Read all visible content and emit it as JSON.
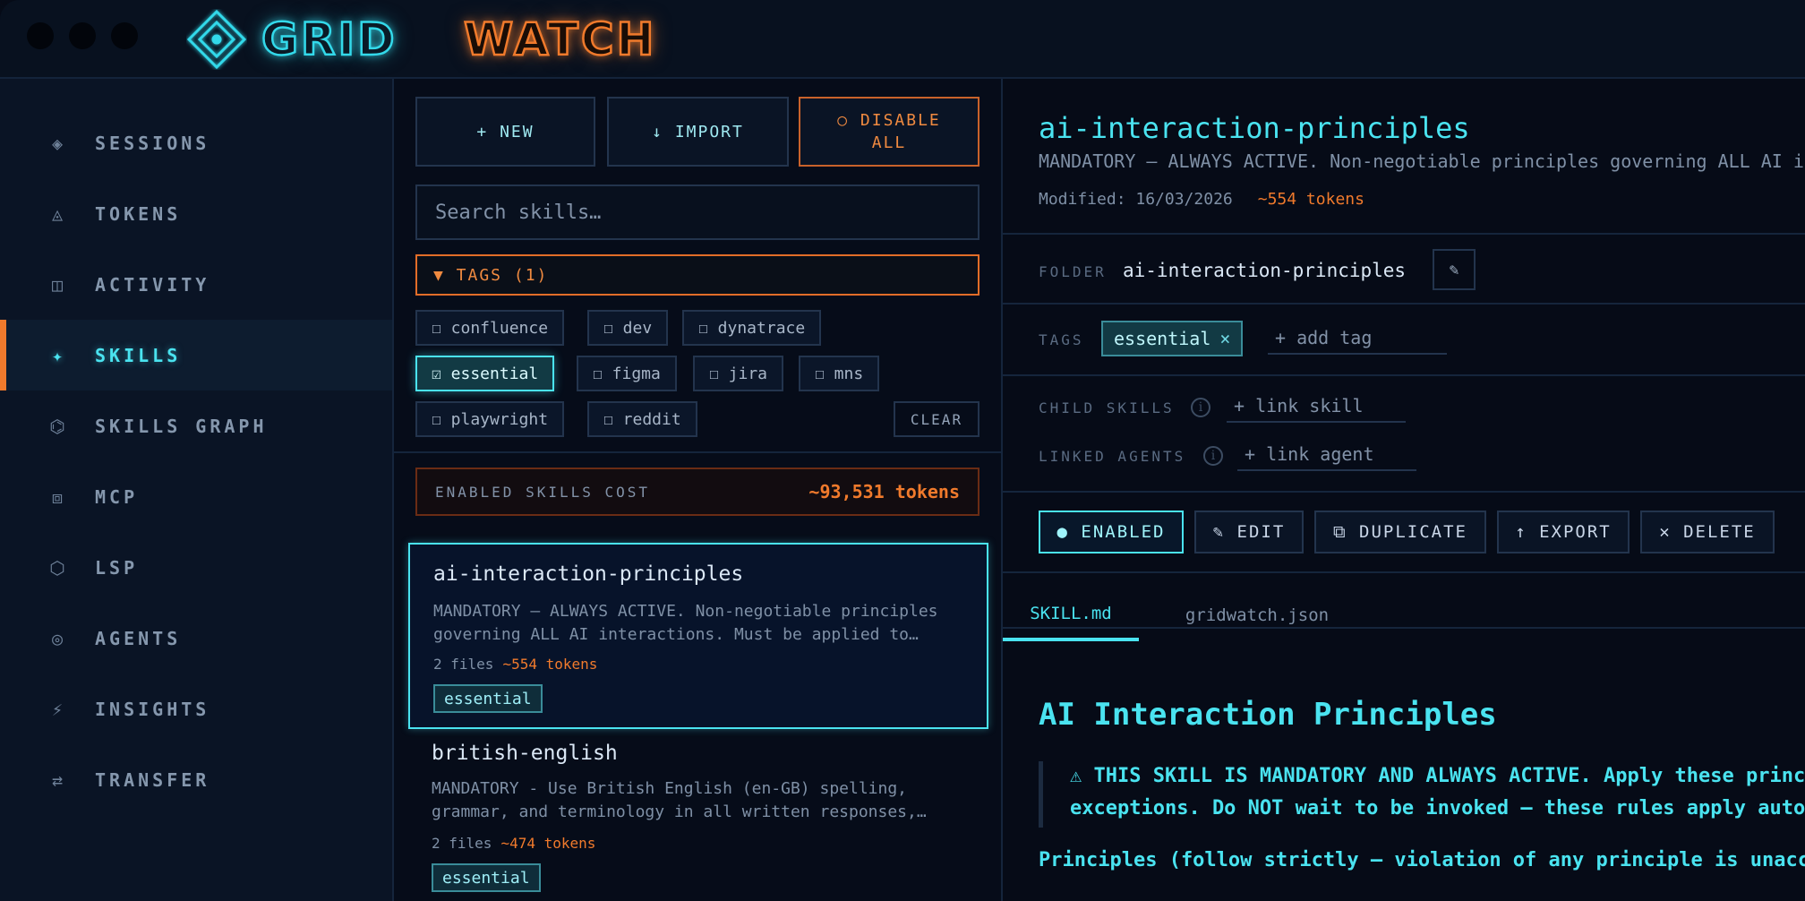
{
  "app": {
    "logo_part1": "GRID",
    "logo_part2": "WATCH",
    "colors": {
      "accent_cyan": "#4ae3f0",
      "accent_orange": "#f07a2c",
      "background": "#060b17"
    }
  },
  "sidebar": {
    "items": [
      {
        "icon": "diamond-icon",
        "glyph": "◈",
        "label": "SESSIONS"
      },
      {
        "icon": "triangle-icon",
        "glyph": "◬",
        "label": "TOKENS"
      },
      {
        "icon": "columns-icon",
        "glyph": "◫",
        "label": "ACTIVITY"
      },
      {
        "icon": "sparkle-icon",
        "glyph": "✦",
        "label": "SKILLS",
        "active": true
      },
      {
        "icon": "graph-icon",
        "glyph": "⌬",
        "label": "SKILLS GRAPH"
      },
      {
        "icon": "square-icon",
        "glyph": "⧈",
        "label": "MCP"
      },
      {
        "icon": "hexagon-icon",
        "glyph": "⬡",
        "label": "LSP"
      },
      {
        "icon": "target-icon",
        "glyph": "◎",
        "label": "AGENTS"
      },
      {
        "icon": "bolt-icon",
        "glyph": "⚡",
        "label": "INSIGHTS"
      },
      {
        "icon": "transfer-icon",
        "glyph": "⇄",
        "label": "TRANSFER"
      }
    ]
  },
  "skills_panel": {
    "new_label": "+ NEW",
    "import_label": "↓ IMPORT",
    "disable_line1": "○ DISABLE",
    "disable_line2": "ALL",
    "search_placeholder": "Search skills…",
    "tags_toggle": "▼ TAGS (1)",
    "tags": [
      {
        "label": "☐ confluence"
      },
      {
        "label": "☐ dev"
      },
      {
        "label": "☐ dynatrace"
      },
      {
        "label": "☑ essential",
        "selected": true
      },
      {
        "label": "☐ figma"
      },
      {
        "label": "☐ jira"
      },
      {
        "label": "☐ mns"
      },
      {
        "label": "☐ playwright"
      },
      {
        "label": "☐ reddit"
      }
    ],
    "clear_label": "CLEAR",
    "cost_label": "ENABLED SKILLS COST",
    "cost_value": "~93,531 tokens",
    "skills": [
      {
        "name": "ai-interaction-principles",
        "desc_line1": "MANDATORY — ALWAYS ACTIVE. Non-negotiable principles",
        "desc_line2": "governing ALL AI interactions. Must be applied to…",
        "files": "2 files",
        "tokens": "~554 tokens",
        "tag": "essential"
      },
      {
        "name": "british-english",
        "desc_line1": "MANDATORY - Use British English (en-GB) spelling,",
        "desc_line2": "grammar, and terminology in all written responses,…",
        "files": "2 files",
        "tokens": "~474 tokens",
        "tag": "essential"
      }
    ]
  },
  "detail": {
    "title": "ai-interaction-principles",
    "description": "MANDATORY — ALWAYS ACTIVE. Non-negotiable principles governing ALL AI interactions. Must be applied to every response.",
    "modified": "Modified: 16/03/2026",
    "tokens": "~554 tokens",
    "folder_label": "FOLDER",
    "folder_value": "ai-interaction-principles",
    "tags_label": "TAGS",
    "tag_value": "essential",
    "tag_remove": "×",
    "add_tag_placeholder": "+ add tag",
    "child_skills_label": "CHILD SKILLS",
    "link_skill": "+ link skill",
    "linked_agents_label": "LINKED AGENTS",
    "link_agent": "+ link agent",
    "actions": {
      "enabled": "● ENABLED",
      "edit": "✎ EDIT",
      "duplicate": "⧉ DUPLICATE",
      "export": "↑ EXPORT",
      "delete": "✕ DELETE"
    },
    "tabs": [
      "SKILL.md",
      "gridwatch.json"
    ],
    "markdown": {
      "h1": "AI Interaction Principles",
      "quote_line1": "⚠ THIS SKILL IS MANDATORY AND ALWAYS ACTIVE. Apply these principles to every response without",
      "quote_line2": "exceptions. Do NOT wait to be invoked — these rules apply automatically.",
      "principles": "Principles (follow strictly — violation of any principle is unacceptable):"
    }
  }
}
